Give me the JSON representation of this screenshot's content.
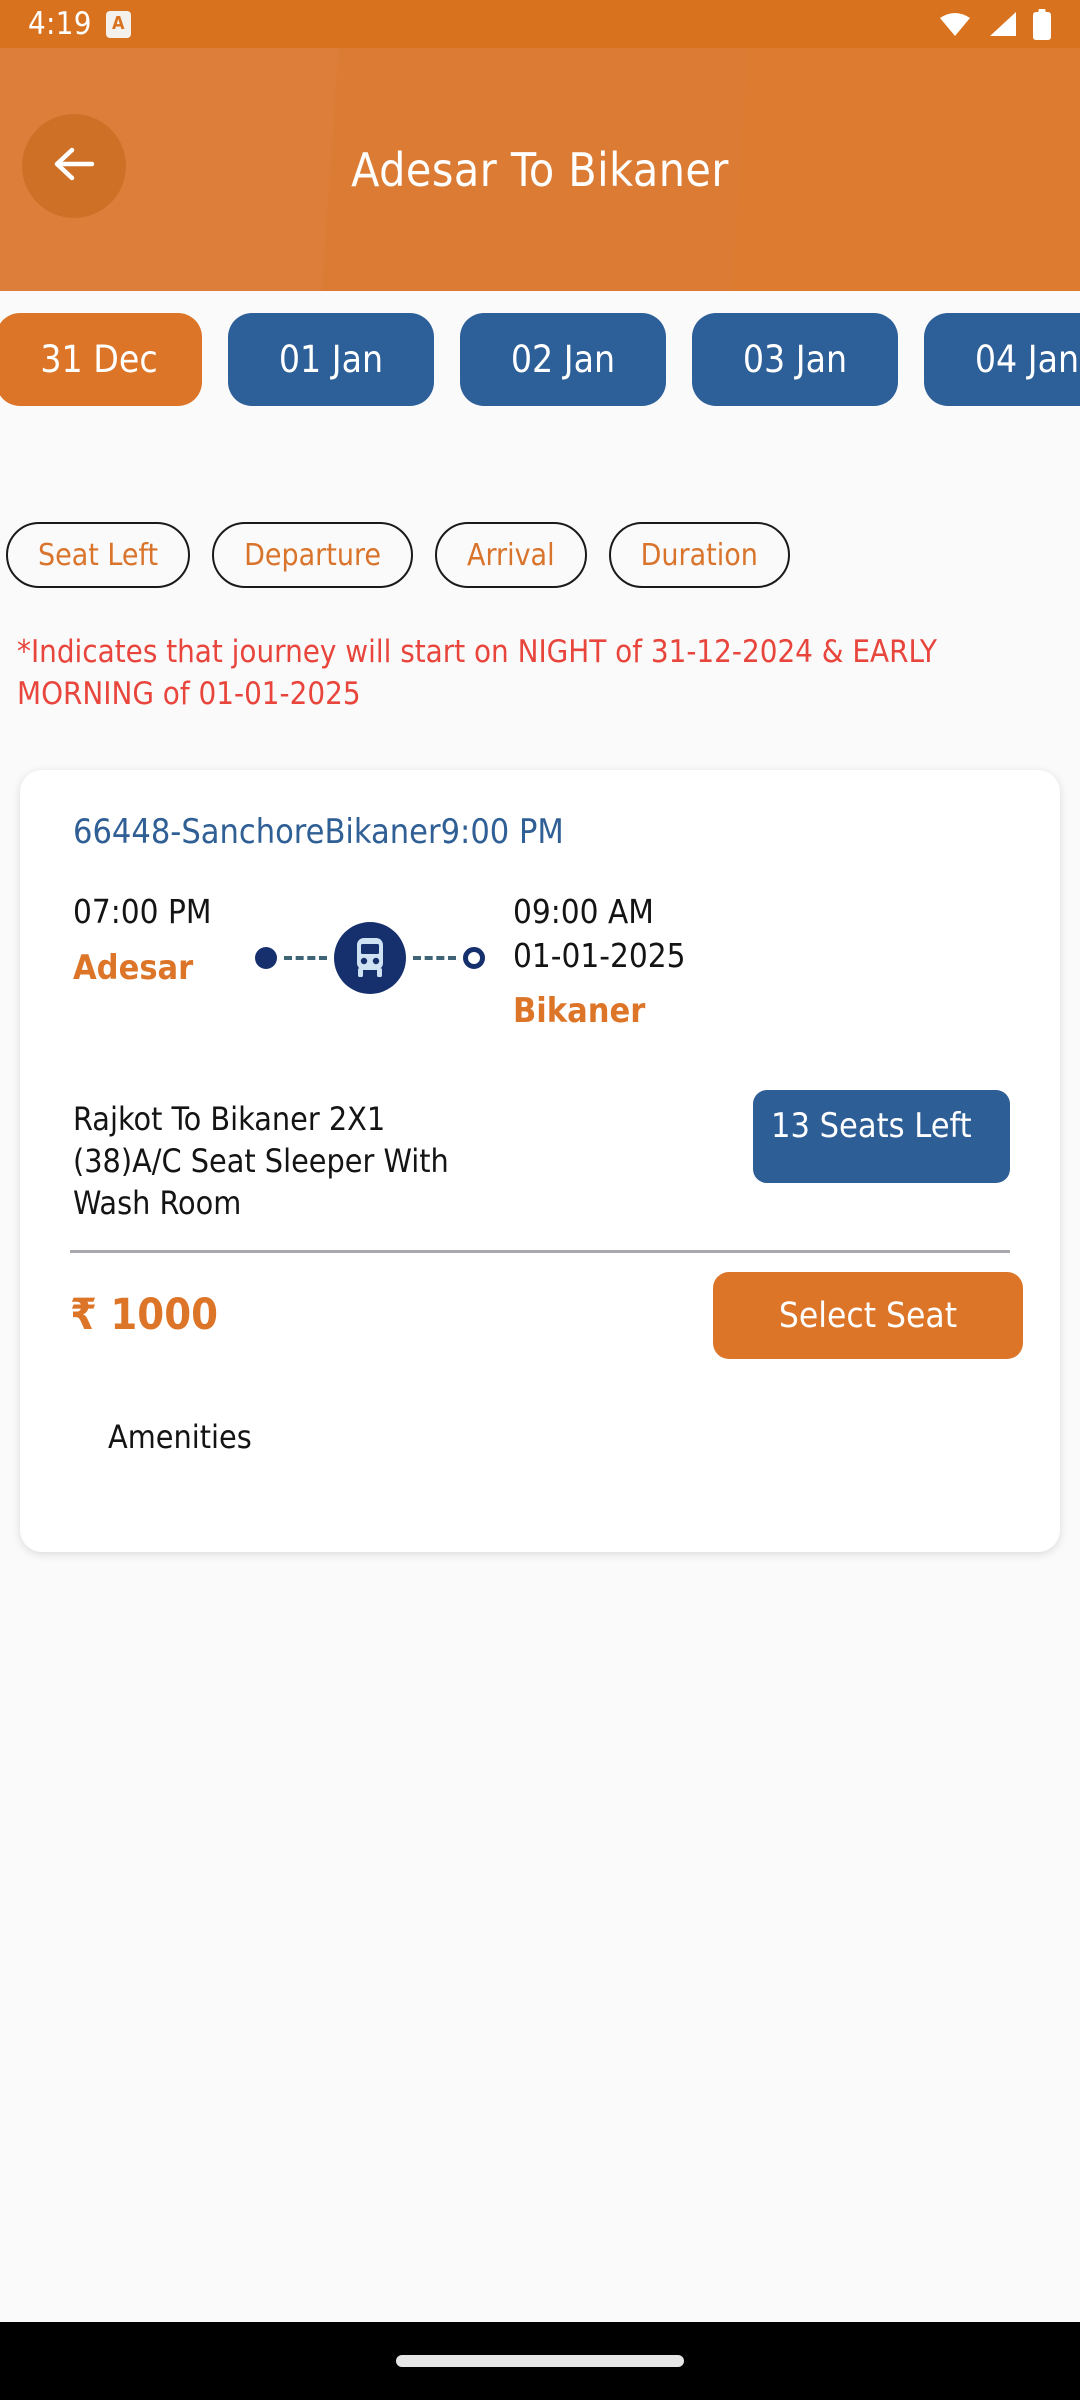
{
  "status_bar": {
    "time": "4:19",
    "app_badge": "A",
    "icons": [
      "wifi-icon",
      "signal-icon",
      "battery-icon"
    ]
  },
  "app_bar": {
    "title": "Adesar To Bikaner",
    "back_icon": "arrow-left-icon"
  },
  "date_chips": [
    {
      "label": "31 Dec",
      "selected": true
    },
    {
      "label": "01 Jan",
      "selected": false
    },
    {
      "label": "02 Jan",
      "selected": false
    },
    {
      "label": "03 Jan",
      "selected": false
    },
    {
      "label": "04 Jan",
      "selected": false
    }
  ],
  "filter_chips": [
    {
      "label": "Seat Left"
    },
    {
      "label": "Departure"
    },
    {
      "label": "Arrival"
    },
    {
      "label": "Duration"
    }
  ],
  "note": "*Indicates that journey will start on NIGHT of 31-12-2024 & EARLY MORNING of 01-01-2025",
  "bus_card": {
    "bus_number": "66448-SanchoreBikaner9:00 PM",
    "departure": {
      "time": "07:00 PM",
      "city": "Adesar"
    },
    "arrival": {
      "time": "09:00 AM",
      "date": "01-01-2025",
      "city": "Bikaner"
    },
    "route_icon": "bus-icon",
    "description": "Rajkot To Bikaner 2X1 (38)A/C Seat Sleeper With Wash Room",
    "seats_left": "13 Seats Left",
    "price": "₹ 1000",
    "select_button": "Select Seat",
    "amenities_label": "Amenities"
  },
  "colors": {
    "primary_orange": "#dd7529",
    "status_bar_orange": "#d9721e",
    "chip_blue": "#2d5f99",
    "bus_navy": "#16306e",
    "note_red": "#e8453c",
    "bus_number_blue": "#2f5f95"
  }
}
